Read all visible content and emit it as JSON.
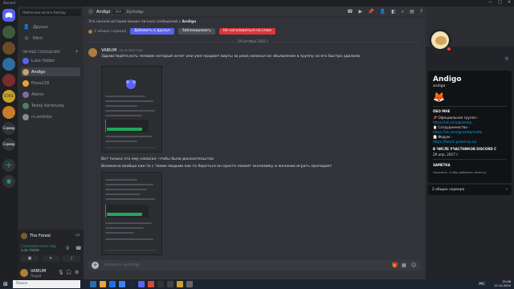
{
  "window": {
    "title": "Discord",
    "controls": [
      "—",
      "□",
      "✕"
    ]
  },
  "sidebar": {
    "search_placeholder": "Найти или начать беседу",
    "nav": [
      {
        "label": "Друзья",
        "icon": "friends-icon"
      },
      {
        "label": "Nitro",
        "icon": "nitro-icon"
      }
    ],
    "dm_header": "ЛИЧНЫЕ СООБЩЕНИЯ",
    "dms": [
      {
        "name": "Luke Hobbs",
        "color": "#5865f2"
      },
      {
        "name": "Andigo",
        "color": "#c9a070",
        "active": true
      },
      {
        "name": "Pizza228",
        "color": "#e8a33c"
      },
      {
        "name": "Akeno",
        "color": "#7a6fa0"
      },
      {
        "name": "Teddy Kerkovsky",
        "color": "#4e7d6a"
      },
      {
        "name": "m.emkilov",
        "color": "#8a8a8a"
      }
    ],
    "voice": {
      "server": "The Forest",
      "status": "Голосовая связь под",
      "sub": "Luke Hobbs"
    },
    "user": {
      "name": "VABIUM",
      "status": "Подуй"
    }
  },
  "servers": [
    {
      "label": "",
      "color": "#5865f2"
    },
    {
      "label": "",
      "color": "#3b5b3a"
    },
    {
      "label": "",
      "color": "#6b4a2a"
    },
    {
      "label": "",
      "color": "#2d6e9e"
    },
    {
      "label": "",
      "color": "#7a2d2d"
    },
    {
      "label": "STATE",
      "color": "#c9a227"
    },
    {
      "label": "",
      "color": "#c97d2a"
    },
    {
      "label": "Сервер",
      "color": "#313338"
    },
    {
      "label": "Сервер",
      "color": "#313338"
    }
  ],
  "header": {
    "name": "Andigo",
    "tag": "ЕКА",
    "handle": "Diy.Andigo"
  },
  "chat": {
    "intro_prefix": "Это начало истории ваших личных сообщений с ",
    "intro_name": "Andigo",
    "mutual_servers": "2 общих сервера",
    "btn_add": "Добавить в друзья",
    "btn_block": "Заблокировать",
    "btn_spam": "Не наголоваться на спам",
    "date_divider": "29 октября 2022 г.",
    "message": {
      "author": "VABIUM",
      "time": "29.10.2022 7:50",
      "line1": "Здравствуйте,есть человек который хочет или уже продает вирты за реал,написал он обьявление в группу но его быстро удалили",
      "line2": "Вот только это ему написал, чтобы были доказательства",
      "line3": "Возможно вообще как-то с таким людьми как-то бороться он просто ломает экономику и желание играть пропадает"
    },
    "composer_placeholder": "Написать @Andigo"
  },
  "profile": {
    "name": "Andigo",
    "username": "andigo",
    "about_head": "ОБО МНЕ",
    "about_lines": [
      {
        "text": "📌 Официальная группа -",
        "link": false
      },
      {
        "text": "https://vk.com/grandrp...",
        "link": true
      },
      {
        "text": "📋 Сотрудничество -",
        "link": false
      },
      {
        "text": "https://vk.com/grandrpmedia",
        "link": true
      },
      {
        "text": "📄 Форум -",
        "link": false
      },
      {
        "text": "https://forum.grand-rp.su/",
        "link": true
      }
    ],
    "member_head": "В ЧИСЛЕ УЧАСТНИКОВ DISCORD С",
    "member_since": "29 апр. 2017 г.",
    "note_head": "ЗАМЕТКА",
    "note_placeholder": "Нажмите, чтобы добавить заметку",
    "mutual": "2 общих сервера"
  },
  "taskbar": {
    "search": "Поиск",
    "time": "21:46",
    "date": "21.10.2022",
    "lang": "РУС"
  }
}
